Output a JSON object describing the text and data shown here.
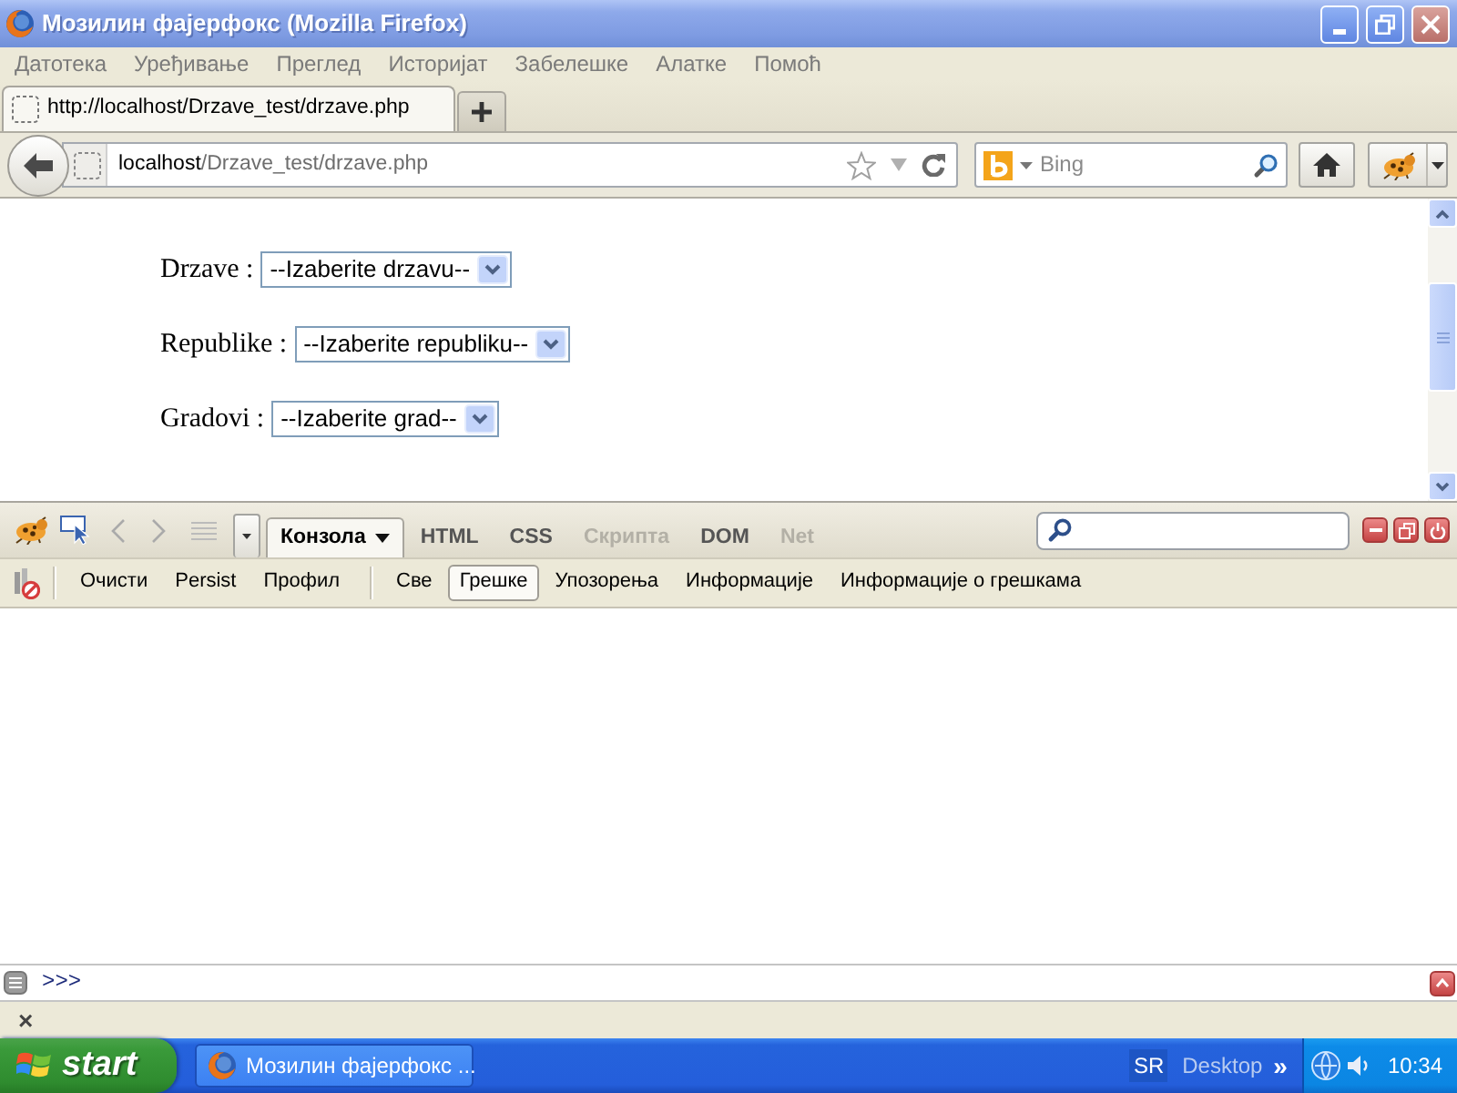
{
  "window": {
    "title": "Мозилин фајерфокс (Mozilla Firefox)"
  },
  "menu": [
    "Датотека",
    "Уређивање",
    "Преглед",
    "Историјат",
    "Забелешке",
    "Алатке",
    "Помоћ"
  ],
  "tabs": [
    {
      "label": "http://localhost/Drzave_test/drzave.php",
      "selected": true
    }
  ],
  "address_bar": {
    "host": "localhost",
    "path": "/Drzave_test/drzave.php"
  },
  "search": {
    "placeholder": "Bing"
  },
  "page": {
    "fields": [
      {
        "label": "Drzave :",
        "value": "--Izaberite drzavu--"
      },
      {
        "label": "Republike :",
        "value": "--Izaberite republiku--"
      },
      {
        "label": "Gradovi :",
        "value": "--Izaberite grad--"
      }
    ]
  },
  "devtools": {
    "tabs": [
      {
        "label": "Конзола",
        "selected": true,
        "disabled": false
      },
      {
        "label": "HTML",
        "selected": false,
        "disabled": false
      },
      {
        "label": "CSS",
        "selected": false,
        "disabled": false
      },
      {
        "label": "Скрипта",
        "selected": false,
        "disabled": true
      },
      {
        "label": "DOM",
        "selected": false,
        "disabled": false
      },
      {
        "label": "Net",
        "selected": false,
        "disabled": true
      }
    ],
    "console_buttons": [
      "Очисти",
      "Persist",
      "Профил"
    ],
    "filters": [
      {
        "label": "Све",
        "selected": false
      },
      {
        "label": "Грешке",
        "selected": true
      },
      {
        "label": "Упозорења",
        "selected": false
      },
      {
        "label": "Информације",
        "selected": false
      },
      {
        "label": "Информације о грешкама",
        "selected": false
      }
    ],
    "command_prompt": ">>>"
  },
  "find_bar": {
    "close": "×"
  },
  "taskbar": {
    "start": "start",
    "tasks": [
      {
        "label": "Мозилин фајерфокс ..."
      }
    ],
    "language": "SR",
    "toolbar": "Desktop",
    "expand": "»",
    "clock": "10:34"
  }
}
